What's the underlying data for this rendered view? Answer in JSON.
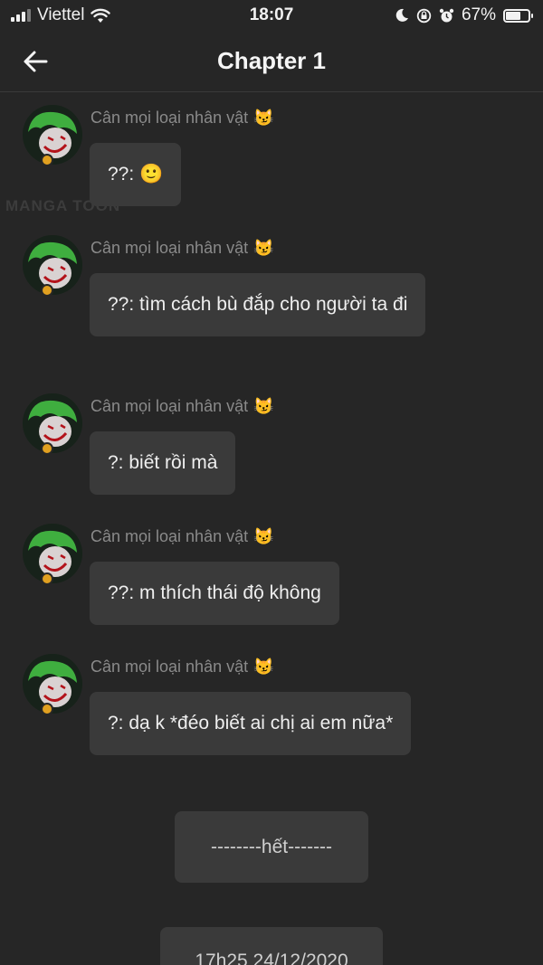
{
  "status_bar": {
    "carrier": "Viettel",
    "time": "18:07",
    "battery_percent": "67%",
    "battery_level": 0.67
  },
  "nav": {
    "title": "Chapter 1"
  },
  "watermark": "MANGA TOON",
  "messages": [
    {
      "sender": "Cân mọi loại nhân vật",
      "sender_emoji": "😼",
      "text": "??: 🙂"
    },
    {
      "sender": "Cân mọi loại nhân vật",
      "sender_emoji": "😼",
      "text": "??: tìm cách bù đắp cho người ta đi"
    },
    {
      "sender": "Cân mọi loại nhân vật",
      "sender_emoji": "😼",
      "text": "?: biết rồi mà"
    },
    {
      "sender": "Cân mọi loại nhân vật",
      "sender_emoji": "😼",
      "text": "??: m thích thái độ không"
    },
    {
      "sender": "Cân mọi loại nhân vật",
      "sender_emoji": "😼",
      "text": "?: dạ k *đéo biết ai chị ai em nữa*"
    }
  ],
  "end_label": "--------hết-------",
  "timestamp": "17h25 24/12/2020"
}
